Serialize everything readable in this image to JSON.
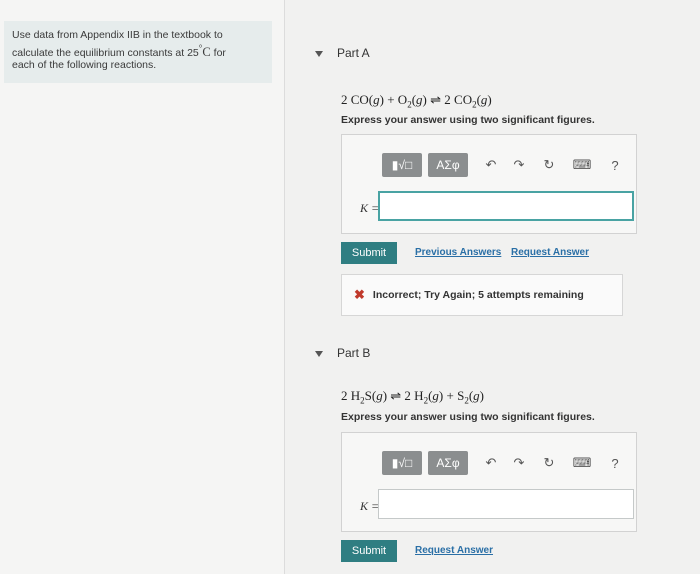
{
  "instructions": {
    "line1": "Use data from Appendix IIB in the textbook to",
    "line2_pre": "calculate the equilibrium constants at 25",
    "line2_deg": "°",
    "line2_unit": "C",
    "line2_post": " for",
    "line3": "each of the following reactions."
  },
  "toolbar": {
    "templates": "▮√□",
    "symbols": "ΑΣφ",
    "undo": "↶",
    "redo": "↷",
    "reset": "↻",
    "keyboard": "⌨",
    "help": "?"
  },
  "partA": {
    "title": "Part A",
    "equation": {
      "c1": "2 CO(",
      "g1": "g",
      "c2": ") + O",
      "s1": "2",
      "c3": "(",
      "g2": "g",
      "c4": ") ⇌ 2 CO",
      "s2": "2",
      "c5": "(",
      "g3": "g",
      "c6": ")"
    },
    "instruction": "Express your answer using two significant figures.",
    "k_label": "K =",
    "k_value": "",
    "submit_label": "Submit",
    "previous_answers": "Previous Answers",
    "request_answer": "Request Answer",
    "feedback": "Incorrect; Try Again; 5 attempts remaining",
    "feedback_icon": "✖"
  },
  "partB": {
    "title": "Part B",
    "equation": {
      "c1": "2 H",
      "s1": "2",
      "c2": "S(",
      "g1": "g",
      "c3": ") ⇌ 2 H",
      "s2": "2",
      "c4": "(",
      "g2": "g",
      "c5": ") + S",
      "s3": "2",
      "c6": "(",
      "g3": "g",
      "c7": ")"
    },
    "instruction": "Express your answer using two significant figures.",
    "k_label": "K =",
    "k_value": "",
    "submit_label": "Submit",
    "request_answer": "Request Answer"
  }
}
